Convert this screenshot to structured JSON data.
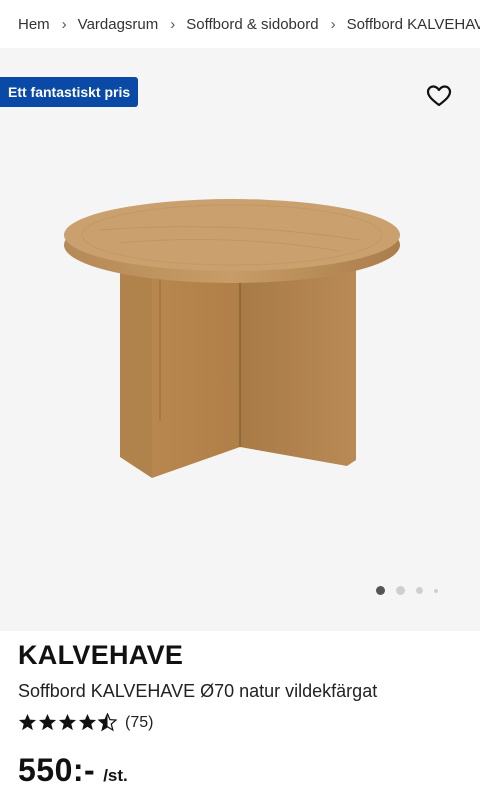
{
  "breadcrumb": [
    {
      "label": "Hem"
    },
    {
      "label": "Vardagsrum"
    },
    {
      "label": "Soffbord & sidobord"
    },
    {
      "label": "Soffbord KALVEHAVE"
    }
  ],
  "promo_badge": "Ett fantastiskt pris",
  "icons": {
    "favorite": "heart-outline-icon",
    "separator": "chevron-right-icon",
    "star": "star-icon"
  },
  "gallery": {
    "image_count": 4,
    "active_index": 0
  },
  "product": {
    "brand": "KALVEHAVE",
    "description": "Soffbord KALVEHAVE Ø70 natur vildekfärgat",
    "rating": 4.5,
    "rating_max": 5,
    "review_count": "(75)",
    "price": "550:-",
    "price_unit": "/st."
  },
  "colors": {
    "promo_bg": "#0a4aa6",
    "hero_bg": "#f5f5f5",
    "dot_active": "#555555",
    "dot_inactive": "#cfcfcf"
  }
}
